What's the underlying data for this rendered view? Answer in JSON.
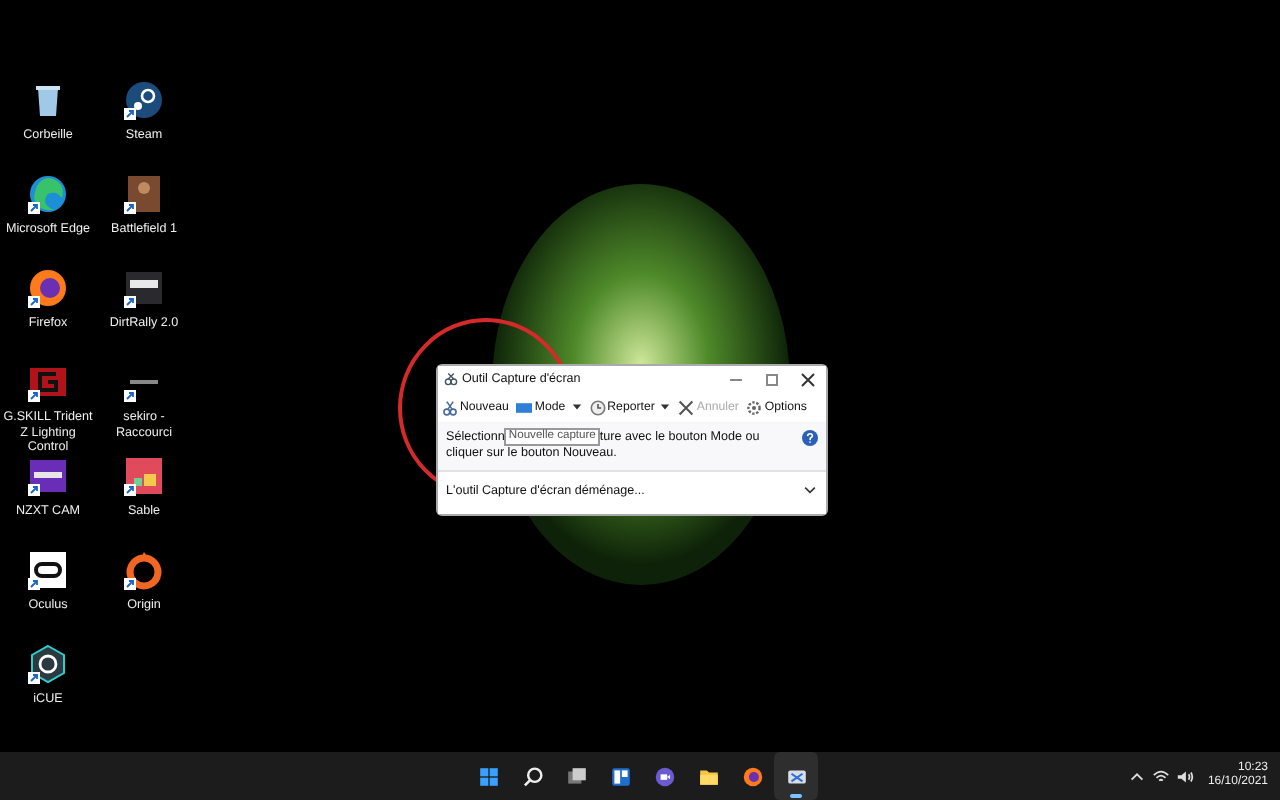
{
  "desktop_icons": [
    {
      "label": "Corbeille",
      "kind": "bin",
      "shortcut": false
    },
    {
      "label": "Steam",
      "kind": "steam",
      "shortcut": true
    },
    {
      "label": "Microsoft Edge",
      "kind": "edge",
      "shortcut": true
    },
    {
      "label": "Battlefield 1",
      "kind": "cover",
      "shortcut": true
    },
    {
      "label": "Firefox",
      "kind": "firefox",
      "shortcut": true
    },
    {
      "label": "DirtRally 2.0",
      "kind": "dirt",
      "shortcut": true
    },
    {
      "label": "G.SKILL Trident Z Lighting Control",
      "kind": "gskill",
      "shortcut": true
    },
    {
      "label": "sekiro - Raccourci",
      "kind": "sekiro",
      "shortcut": true
    },
    {
      "label": "NZXT CAM",
      "kind": "nzxt",
      "shortcut": true
    },
    {
      "label": "Sable",
      "kind": "sable",
      "shortcut": true
    },
    {
      "label": "Oculus",
      "kind": "oculus",
      "shortcut": true
    },
    {
      "label": "Origin",
      "kind": "origin",
      "shortcut": true
    },
    {
      "label": "iCUE",
      "kind": "icue",
      "shortcut": true
    }
  ],
  "window": {
    "title": "Outil Capture d'écran",
    "toolbar": [
      {
        "label": "Nouveau",
        "kind": "new",
        "dropdown": false,
        "disabled": false
      },
      {
        "label": "Mode",
        "kind": "mode",
        "dropdown": true,
        "disabled": false
      },
      {
        "label": "Reporter",
        "kind": "delay",
        "dropdown": true,
        "disabled": false
      },
      {
        "label": "Annuler",
        "kind": "cancel",
        "dropdown": false,
        "disabled": true
      },
      {
        "label": "Options",
        "kind": "options",
        "dropdown": false,
        "disabled": false
      }
    ],
    "message_before": "Sélectionn",
    "tooltip": "Nouvelle capture",
    "message_after": "ture avec le bouton Mode ou",
    "message_line2": "cliquer sur le bouton Nouveau.",
    "footer": "L'outil Capture d'écran déménage..."
  },
  "taskbar": {
    "apps": [
      {
        "kind": "start",
        "active": false
      },
      {
        "kind": "search",
        "active": false
      },
      {
        "kind": "taskview",
        "active": false
      },
      {
        "kind": "widgets",
        "active": false
      },
      {
        "kind": "chat",
        "active": false
      },
      {
        "kind": "folder",
        "active": false
      },
      {
        "kind": "browser",
        "active": false
      },
      {
        "kind": "snip",
        "active": true
      }
    ],
    "time": "10:23",
    "date": "16/10/2021"
  }
}
